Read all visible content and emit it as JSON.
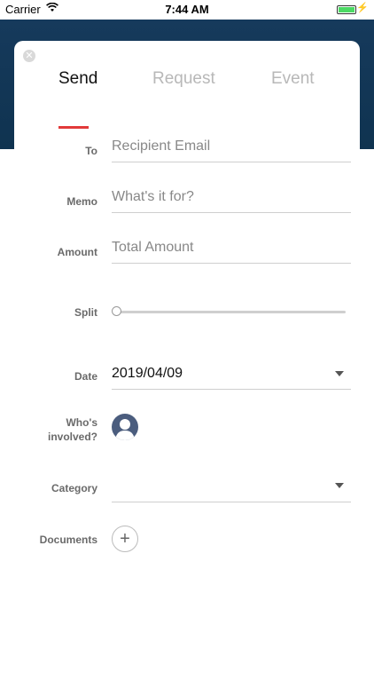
{
  "statusbar": {
    "carrier": "Carrier",
    "time": "7:44 AM",
    "battery_level": 1.0
  },
  "tabs": [
    {
      "label": "Send",
      "active": true
    },
    {
      "label": "Request",
      "active": false
    },
    {
      "label": "Event",
      "active": false
    }
  ],
  "form": {
    "to": {
      "label": "To",
      "placeholder": "Recipient Email"
    },
    "memo": {
      "label": "Memo",
      "placeholder": "What's it for?"
    },
    "amount": {
      "label": "Amount",
      "placeholder": "Total Amount"
    },
    "split": {
      "label": "Split",
      "value": 0
    },
    "date": {
      "label": "Date",
      "value": "2019/04/09"
    },
    "involved": {
      "label_line1": "Who's",
      "label_line2": "involved?"
    },
    "category": {
      "label": "Category",
      "value": ""
    },
    "documents": {
      "label": "Documents"
    }
  },
  "colors": {
    "header": "#0f3350",
    "accent": "#e23a3a",
    "avatar": "#4b5d7e"
  }
}
